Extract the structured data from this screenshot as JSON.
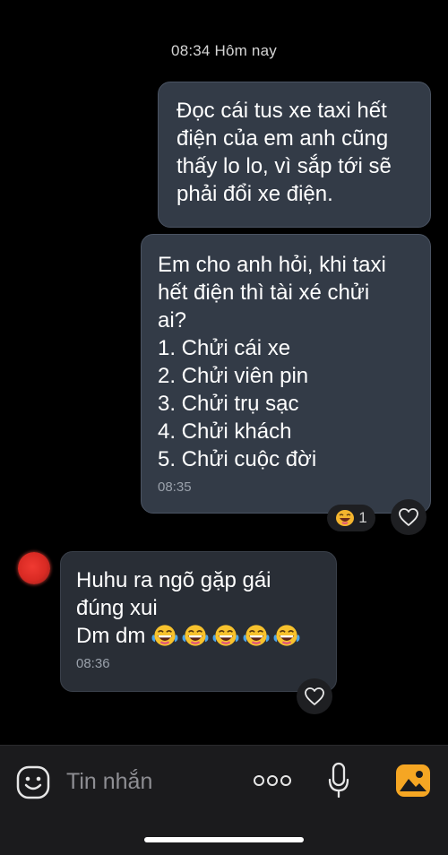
{
  "chat": {
    "date_label": "08:34 Hôm nay",
    "messages": [
      {
        "direction": "outgoing",
        "lines": [
          "Đọc cái tus xe taxi hết",
          "điện của em anh cũng",
          "thấy lo lo, vì sắp tới sẽ",
          "phải đổi xe điện."
        ],
        "time": ""
      },
      {
        "direction": "outgoing",
        "lines": [
          "Em cho anh hỏi, khi taxi",
          "hết điện thì tài xé chửi",
          "ai?",
          "1. Chửi cái xe",
          "2. Chửi viên pin",
          "3. Chửi trụ sạc",
          "4. Chửi khách",
          "5. Chửi cuộc đời"
        ],
        "time": "08:35",
        "reaction": {
          "icon": "laughing-emoji-icon",
          "count": "1"
        }
      },
      {
        "direction": "incoming",
        "lines": [
          "Huhu ra ngõ gặp gái",
          "đúng xui",
          "Dm dm"
        ],
        "emoji_count": 5,
        "emoji": "laughing-tears-emoji-icon",
        "time": "08:36"
      }
    ]
  },
  "composer": {
    "placeholder": "Tin nhắn",
    "icons": [
      "smiley-icon",
      "more-dots-icon",
      "microphone-icon",
      "image-icon"
    ]
  },
  "colors": {
    "background": "#000000",
    "outgoing_bubble": "#333b47",
    "incoming_bubble": "#292e36",
    "image_icon": "#f5a623"
  }
}
